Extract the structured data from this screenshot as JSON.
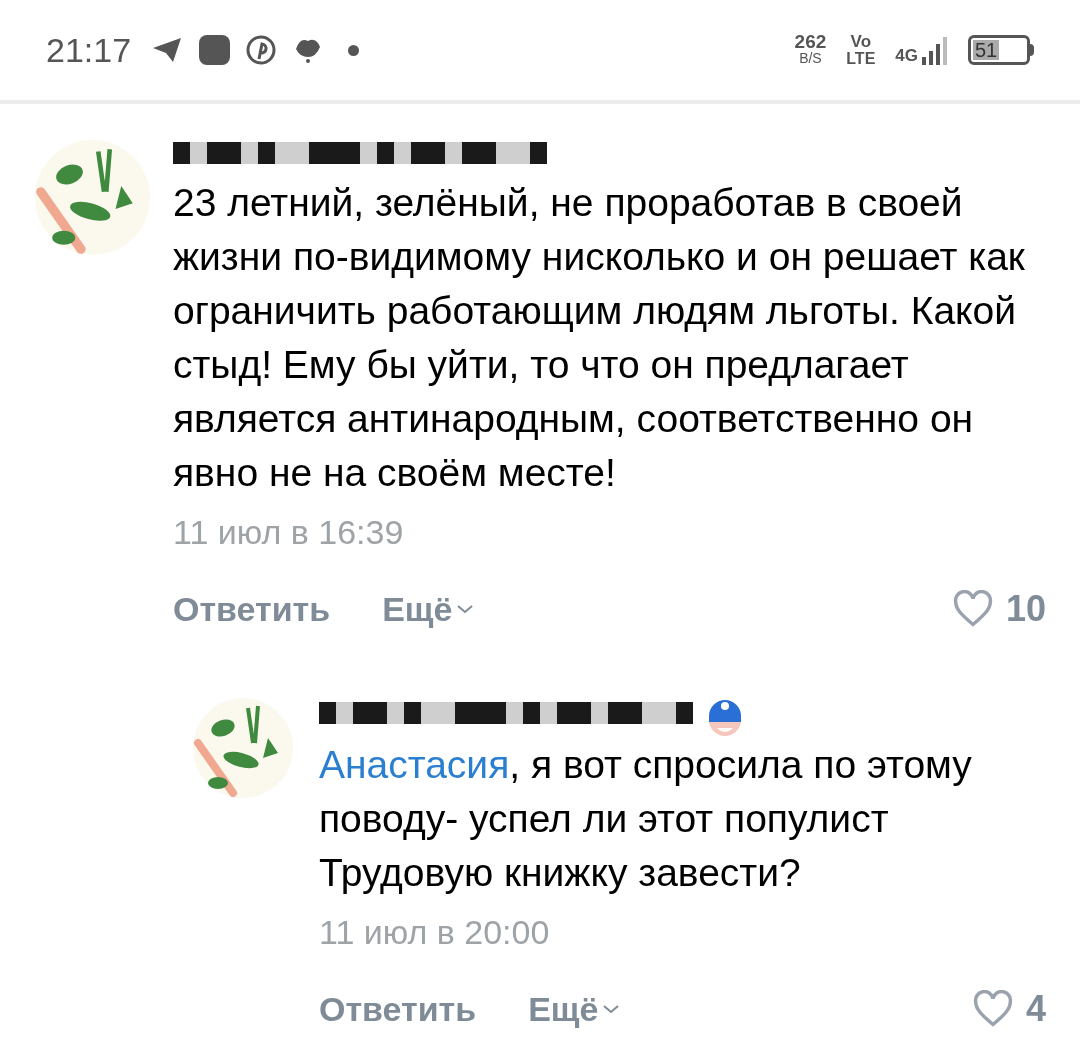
{
  "status_bar": {
    "time": "21:17",
    "speed_value": "262",
    "speed_unit": "B/S",
    "volte_top": "Vo",
    "volte_bottom": "LTE",
    "network": "4G",
    "battery": "51"
  },
  "comments": [
    {
      "text": "23 летний, зелёный, не проработав в своей жизни по-видимому нисколько и он решает как ограничить работающим людям льготы. Какой стыд! Ему бы уйти, то что он предлагает является антинародным, соответственно он явно не на своём месте!",
      "time": "11 июл в 16:39",
      "reply_label": "Ответить",
      "more_label": "Ещё",
      "likes": "10",
      "badge": false,
      "children": [
        {
          "mention": "Анастасия",
          "text": ", я вот спросила по этому поводу- успел ли этот популист Трудовую книжку завести?",
          "time": "11 июл в 20:00",
          "reply_label": "Ответить",
          "more_label": "Ещё",
          "likes": "4",
          "badge": true
        }
      ]
    }
  ]
}
